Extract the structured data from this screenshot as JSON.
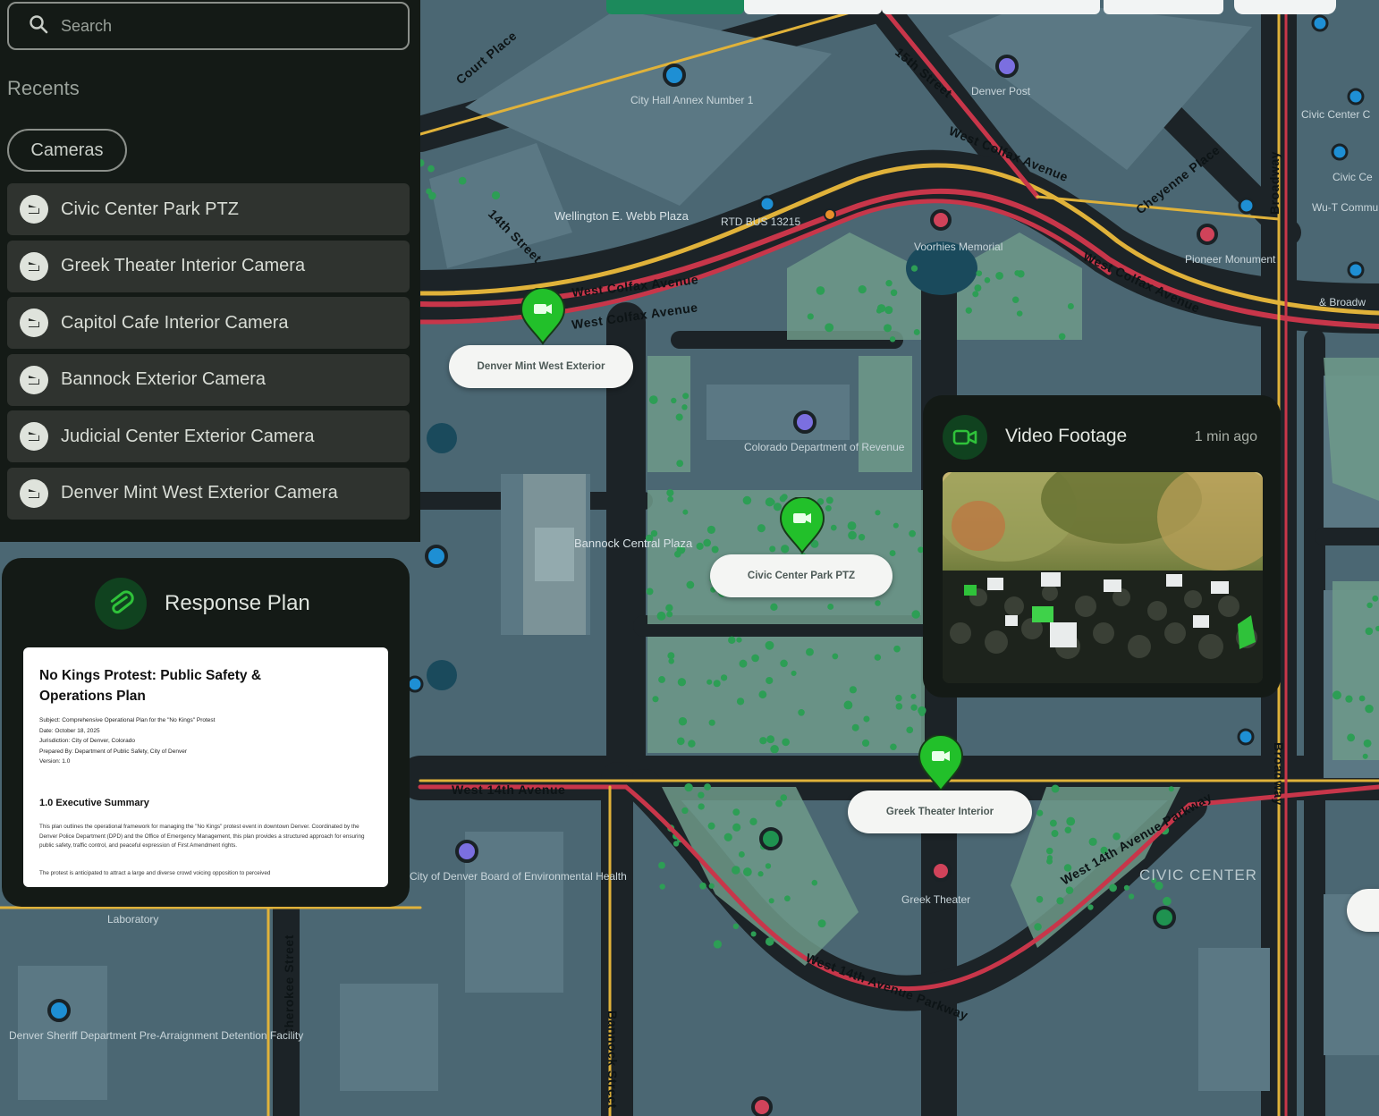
{
  "toolbar": {
    "buttons": [
      "",
      "",
      "",
      "",
      ""
    ]
  },
  "search": {
    "placeholder": "Search"
  },
  "recents": {
    "heading": "Recents",
    "filter_chip": "Cameras"
  },
  "cameras": [
    "Civic Center Park PTZ",
    "Greek Theater Interior Camera",
    "Capitol Cafe Interior Camera",
    "Bannock Exterior Camera",
    "Judicial Center Exterior Camera",
    "Denver Mint West Exterior Camera"
  ],
  "response_plan": {
    "title": "Response Plan",
    "doc_title": "No Kings Protest: Public Safety & Operations Plan",
    "meta": {
      "subject": "Subject: Comprehensive Operational Plan for the \"No Kings\" Protest",
      "date": "Date: October 18, 2025",
      "jurisdiction": "Jurisdiction: City of Denver, Colorado",
      "prepared_by": "Prepared By: Department of Public Safety, City of Denver",
      "version": "Version: 1.0"
    },
    "section": "1.0 Executive Summary",
    "body1": "This plan outlines the operational framework for managing the \"No Kings\" protest event in downtown Denver. Coordinated by the Denver Police Department (DPD) and the Office of Emergency Management, this plan provides a structured approach for ensuring public safety, traffic control, and peaceful expression of First Amendment rights.",
    "body2": "The protest is anticipated to attract a large and diverse crowd voicing opposition to perceived"
  },
  "video": {
    "title": "Video Footage",
    "time": "1 min ago"
  },
  "map_markers": [
    {
      "label": "Denver Mint West Exterior"
    },
    {
      "label": "Civic Center Park PTZ"
    },
    {
      "label": "Greek Theater Interior"
    }
  ],
  "map_labels": {
    "wellington": "Wellington E. Webb Plaza",
    "city_hall": "City Hall Annex Number 1",
    "denver_post": "Denver Post",
    "voorhies": "Voorhies Memorial",
    "pioneer": "Pioneer Monument",
    "colorado_rev": "Colorado Department of Revenue",
    "bannock_plaza": "Bannock Central Plaza",
    "greek_theater": "Greek Theater",
    "civic_center": "CIVIC CENTER",
    "env_health": "City of Denver Board of Environmental Health",
    "sheriff": "Denver Sheriff Department Pre-Arraignment Detention Facility",
    "laboratory": "Laboratory",
    "rtd": "RTD BUS 13215",
    "civic_center_c": "Civic Center C",
    "civic_ce": "Civic Ce",
    "wu_t": "Wu-T Commun Gravel",
    "broadway_lbl": "& Broadw"
  },
  "street_labels": {
    "west_colfax_1": "West Colfax Avenue",
    "west_colfax_2": "West Colfax Avenue",
    "west_colfax_3": "West Colfax Avenue",
    "west_colfax_4": "West Colfax Avenue",
    "west_14th": "West 14th Avenue",
    "west_14th_pkwy": "West 14th Avenue Parkway",
    "west_14th_pkwy2": "West 14th Avenue Parkway",
    "fourteenth": "14th Street",
    "fifteenth": "15th Street",
    "court_place": "Court Place",
    "cheyenne": "Cheyenne Place",
    "broadway": "Broadway",
    "bannock": "Bannock Street",
    "cherokee": "Cherokee Street",
    "broadway2": "Broadway"
  },
  "colors": {
    "accent_green": "#22c02a",
    "panel_bg": "#141a16",
    "map_bg": "#4a6672",
    "traffic_red": "#c8364a",
    "road_yellow": "#e0b23a"
  }
}
